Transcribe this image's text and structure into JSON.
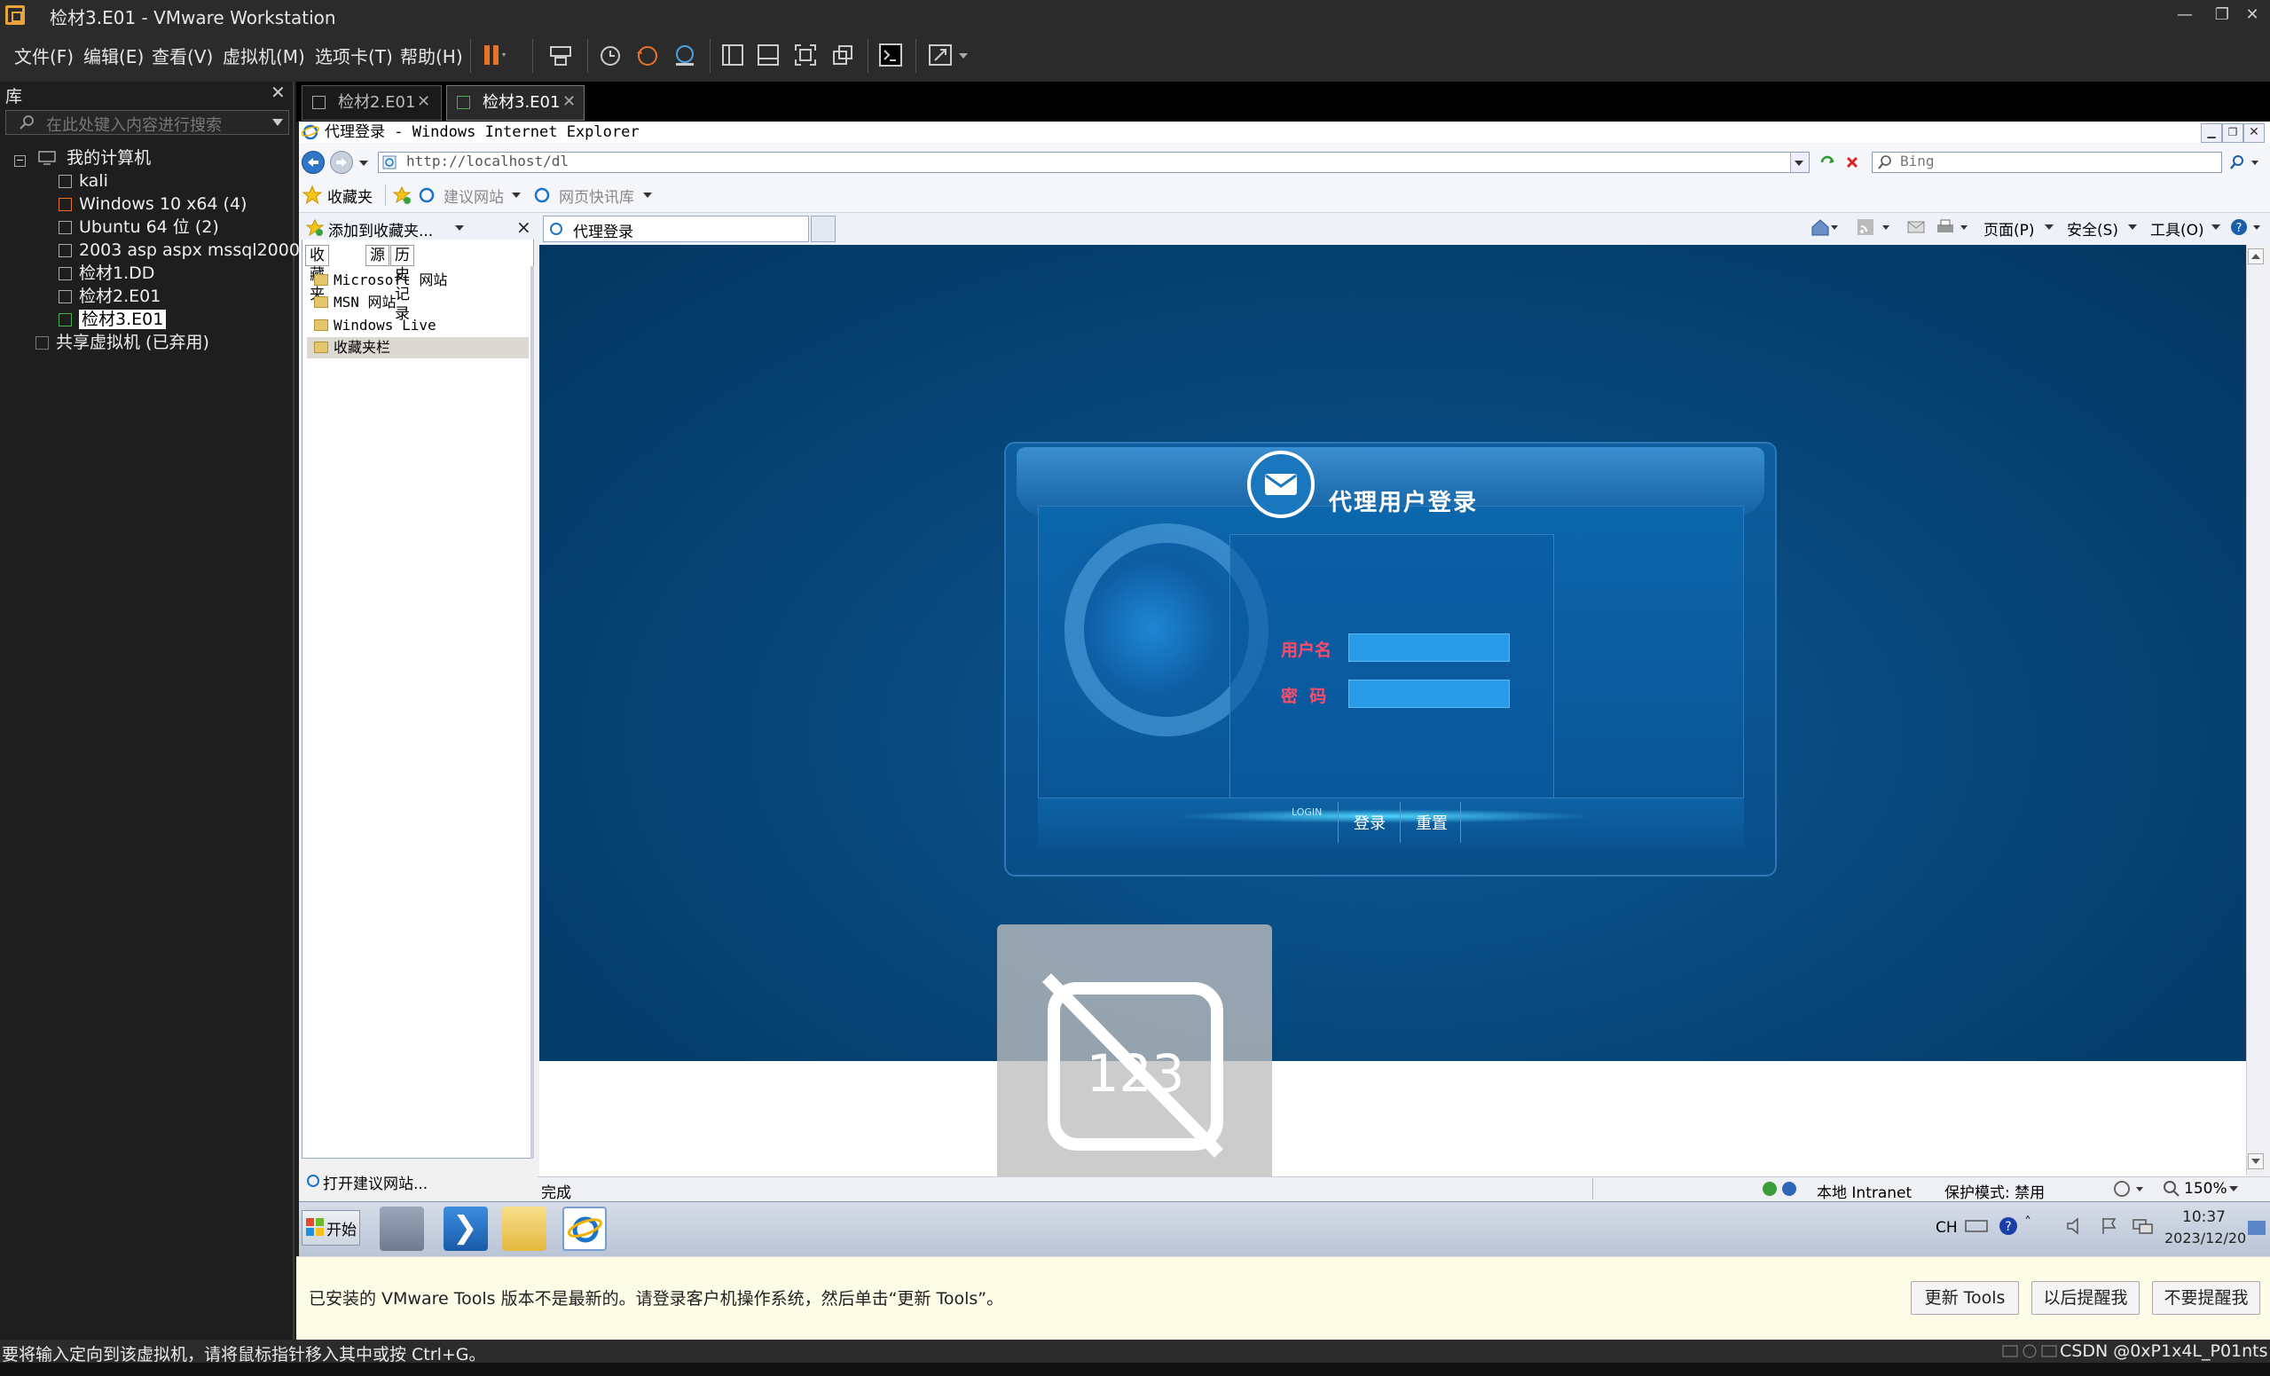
{
  "window": {
    "title": "检材3.E01 - VMware Workstation",
    "controls": {
      "minimize": "—",
      "restore": "❐",
      "close": "✕"
    }
  },
  "menu": [
    "文件(F)",
    "编辑(E)",
    "查看(V)",
    "虚拟机(M)",
    "选项卡(T)",
    "帮助(H)"
  ],
  "library": {
    "title": "库",
    "close": "✕",
    "search_placeholder": "在此处键入内容进行搜索",
    "tree": {
      "root": "我的计算机",
      "items": [
        "kali",
        "Windows 10 x64 (4)",
        "Ubuntu 64 位 (2)",
        "2003 asp aspx mssql2000",
        "检材1.DD",
        "检材2.E01",
        "检材3.E01"
      ],
      "shared": "共享虚拟机 (已弃用)"
    }
  },
  "tabs": [
    {
      "label": "检材2.E01",
      "close": "✕"
    },
    {
      "label": "检材3.E01",
      "close": "✕"
    }
  ],
  "ie": {
    "title": "代理登录 - Windows Internet Explorer",
    "address": "http://localhost/dl",
    "search_placeholder": "Bing",
    "favorites_label": "收藏夹",
    "suggested_sites": "建议网站",
    "web_slice": "网页快讯库",
    "add_favorites": "添加到收藏夹...",
    "pane_close": "×",
    "pane_tabs": [
      "收藏夹",
      "源",
      "历史记录"
    ],
    "fav_items": [
      "Microsoft 网站",
      "MSN 网站",
      "Windows Live",
      "收藏夹栏"
    ],
    "pane_footer": "打开建议网站...",
    "tab_label": "代理登录",
    "cmd": {
      "page": "页面(P)",
      "safety": "安全(S)",
      "tools": "工具(O)"
    },
    "status": {
      "done": "完成",
      "zone": "本地 Intranet",
      "protected": "保护模式: 禁用",
      "zoom": "150%"
    }
  },
  "login": {
    "title": "代理用户登录",
    "username_label": "用户名",
    "password_label": "密  码",
    "bar_caption": "LOGIN",
    "login_btn": "登录",
    "reset_btn": "重置"
  },
  "overlay": {
    "keypad_text": "123"
  },
  "taskbar": {
    "start": "开始",
    "lang": "CH",
    "time": "10:37",
    "date": "2023/12/20"
  },
  "notification": {
    "text": "已安装的 VMware Tools 版本不是最新的。请登录客户机操作系统，然后单击“更新 Tools”。",
    "buttons": [
      "更新 Tools",
      "以后提醒我",
      "不要提醒我"
    ]
  },
  "vm_status": {
    "hint": "要将输入定向到该虚拟机，请将鼠标指针移入其中或按 Ctrl+G。",
    "watermark": "CSDN @0xP1x4L_P01nts"
  },
  "colors": {
    "accent_orange": "#e8a33a",
    "page_blue": "#064476",
    "label_red": "#ff4b6a",
    "input_blue": "#2a9be8"
  }
}
